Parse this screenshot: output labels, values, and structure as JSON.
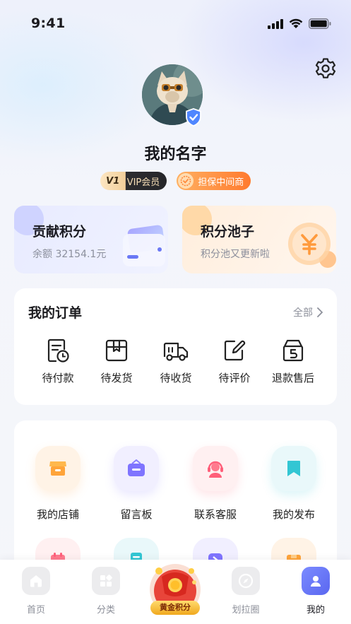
{
  "status_bar": {
    "time": "9:41"
  },
  "profile": {
    "name": "我的名字",
    "vip_level": "V1",
    "vip_label": "VIP会员",
    "guarantee_label": "担保中间商"
  },
  "cards": {
    "points": {
      "title": "贡献积分",
      "subtitle": "余额 32154.1元"
    },
    "pool": {
      "title": "积分池子",
      "subtitle": "积分池又更新啦",
      "icon": "yen-icon"
    }
  },
  "orders": {
    "title": "我的订单",
    "all_label": "全部",
    "items": [
      {
        "label": "待付款",
        "icon": "pending-payment-icon"
      },
      {
        "label": "待发货",
        "icon": "pending-shipment-icon"
      },
      {
        "label": "待收货",
        "icon": "pending-receipt-icon"
      },
      {
        "label": "待评价",
        "icon": "pending-review-icon"
      },
      {
        "label": "退款售后",
        "icon": "refund-icon"
      }
    ]
  },
  "services": {
    "items": [
      {
        "label": "我的店铺",
        "icon": "store-icon"
      },
      {
        "label": "留言板",
        "icon": "message-board-icon"
      },
      {
        "label": "联系客服",
        "icon": "customer-service-icon"
      },
      {
        "label": "我的发布",
        "icon": "bookmark-icon"
      }
    ]
  },
  "tabbar": {
    "items": [
      {
        "label": "首页",
        "icon": "home-icon"
      },
      {
        "label": "分类",
        "icon": "category-icon"
      },
      {
        "label": "黄金积分",
        "icon": "gold-points-icon"
      },
      {
        "label": "划拉圈",
        "icon": "compass-icon"
      },
      {
        "label": "我的",
        "icon": "profile-icon"
      }
    ],
    "active_index": 4
  },
  "colors": {
    "accent": "#6a78f5",
    "orange": "#ff8a3d",
    "vip_dark": "#26262a"
  }
}
